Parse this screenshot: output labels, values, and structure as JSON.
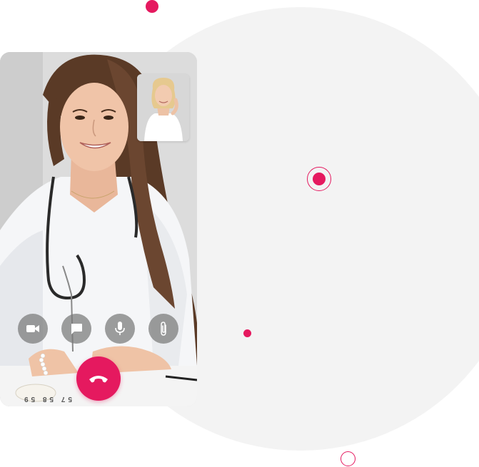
{
  "call": {
    "controls": [
      {
        "name": "video-camera",
        "icon": "video-camera-icon"
      },
      {
        "name": "chat",
        "icon": "chat-bubble-icon"
      },
      {
        "name": "microphone",
        "icon": "microphone-icon"
      },
      {
        "name": "attachment",
        "icon": "paperclip-icon"
      }
    ],
    "end_call_icon": "phone-hangup-icon",
    "tape_numbers": "57 58 59"
  },
  "colors": {
    "accent": "#e5195f",
    "background_circle": "#f3f3f3",
    "control_button": "#787878"
  }
}
